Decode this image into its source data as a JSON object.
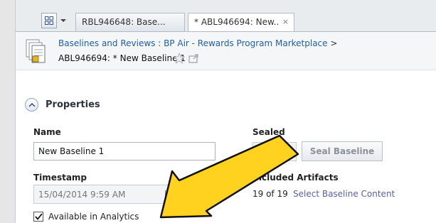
{
  "tabs": [
    {
      "label": "RBL946648: Base..."
    },
    {
      "label": "* ABL946694: New..",
      "close": "×"
    }
  ],
  "header": {
    "breadcrumb": "Baselines and Reviews : BP Air - Rewards Program Marketplace",
    "breadcrumb_sep": ">",
    "title": "ABL946694: * New Baseline 1"
  },
  "section": {
    "title": "Properties"
  },
  "fields": {
    "name_label": "Name",
    "name_value": "New Baseline 1",
    "sealed_label": "Sealed",
    "seal_button": "Seal Baseline",
    "timestamp_label": "Timestamp",
    "timestamp_value": "15/04/2014 9:59 AM",
    "artifacts_label": "Included Artifacts",
    "artifacts_count": "19 of 19",
    "select_link": "Select Baseline Content",
    "analytics_label": "Available in Analytics"
  },
  "colors": {
    "link": "#1f5fa6",
    "arrow_fill": "#ffd21f",
    "arrow_stroke": "#111111"
  }
}
